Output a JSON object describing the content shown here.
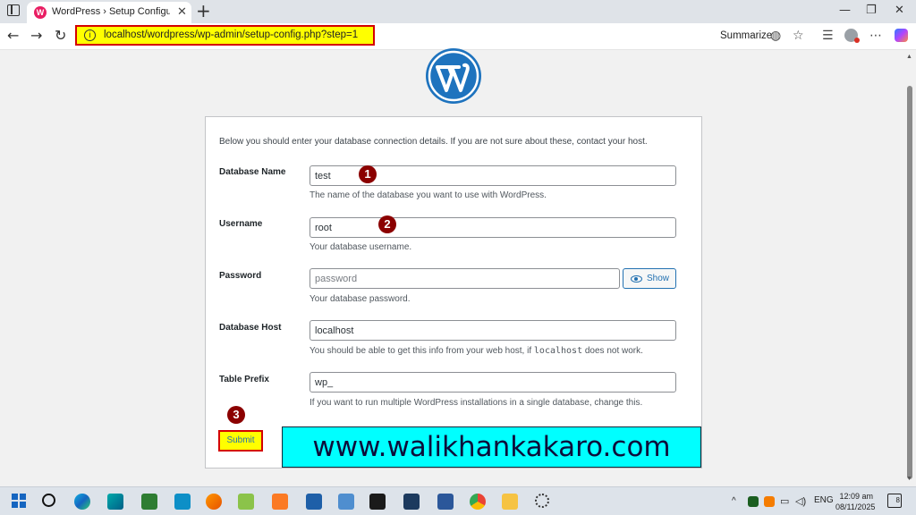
{
  "browser": {
    "tab": {
      "title": "WordPress › Setup Configuration",
      "favicon": "wp-favicon-icon"
    },
    "address_bar": {
      "url": "localhost/wordpress/wp-admin/setup-config.php?step=1"
    },
    "toolbar": {
      "summarize_label": "Summarize"
    }
  },
  "form": {
    "intro": "Below you should enter your database connection details. If you are not sure about these, contact your host.",
    "fields": [
      {
        "label": "Database Name",
        "value": "test",
        "hint": "The name of the database you want to use with WordPress."
      },
      {
        "label": "Username",
        "value": "root",
        "hint": "Your database username."
      },
      {
        "label": "Password",
        "placeholder": "password",
        "hint": "Your database password.",
        "show_label": "Show"
      },
      {
        "label": "Database Host",
        "value": "localhost",
        "hint_before": "You should be able to get this info from your web host, if ",
        "hint_code": "localhost",
        "hint_after": " does not work."
      },
      {
        "label": "Table Prefix",
        "value": "wp_",
        "hint": "If you want to run multiple WordPress installations in a single database, change this."
      }
    ],
    "submit_label": "Submit"
  },
  "annotations": {
    "badge1": "1",
    "badge2": "2",
    "badge3": "3",
    "watermark": "www.walikhankakaro.com"
  },
  "taskbar": {
    "language": "ENG",
    "time": "12:09 am",
    "date": "08/11/2025",
    "notification_count": "8"
  },
  "colors": {
    "wp_blue": "#2271b1",
    "highlight_yellow": "#ffff00",
    "highlight_red": "#d40000",
    "badge_red": "#8b0000",
    "watermark_cyan": "#00ffff"
  }
}
